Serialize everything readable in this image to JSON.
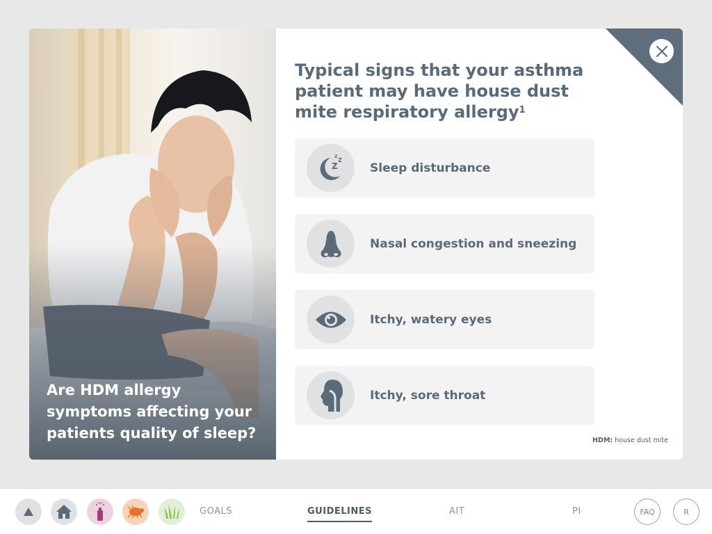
{
  "hero": {
    "caption": "Are HDM allergy symptoms affecting your patients quality of sleep?"
  },
  "panel": {
    "title": "Typical signs that your asthma patient may have house dust mite respiratory allergy",
    "title_sup": "1",
    "close_icon": "close-icon",
    "symptoms": [
      {
        "icon": "sleep-moon-icon",
        "label": "Sleep disturbance"
      },
      {
        "icon": "nose-icon",
        "label": "Nasal congestion and sneezing"
      },
      {
        "icon": "eye-icon",
        "label": "Itchy, watery eyes"
      },
      {
        "icon": "throat-icon",
        "label": "Itchy, sore throat"
      }
    ],
    "footnote_abbr": "HDM:",
    "footnote_text": "house dust mite"
  },
  "bottom_nav": {
    "circles": [
      {
        "icon": "up-arrow-icon",
        "color": "#dfe1e3"
      },
      {
        "icon": "home-icon",
        "color": "#dfe1e3"
      },
      {
        "icon": "spray-bottle-icon",
        "color": "#ecd3e2"
      },
      {
        "icon": "dust-mite-icon",
        "color": "#f8d3b8"
      },
      {
        "icon": "grass-icon",
        "color": "#e3efd4"
      }
    ],
    "links": [
      {
        "label": "GOALS",
        "active": false
      },
      {
        "label": "GUIDELINES",
        "active": true
      },
      {
        "label": "AIT",
        "active": false
      },
      {
        "label": "PI",
        "active": false
      }
    ],
    "faq_label": "FAQ",
    "r_label": "R"
  },
  "colors": {
    "title": "#5a6a78",
    "corner": "#5e6e7c",
    "card_bg": "#f3f3f3",
    "icon_bg": "#dfe1e3",
    "icon_fg": "#5a6a78",
    "background": "#e8e8e8"
  }
}
